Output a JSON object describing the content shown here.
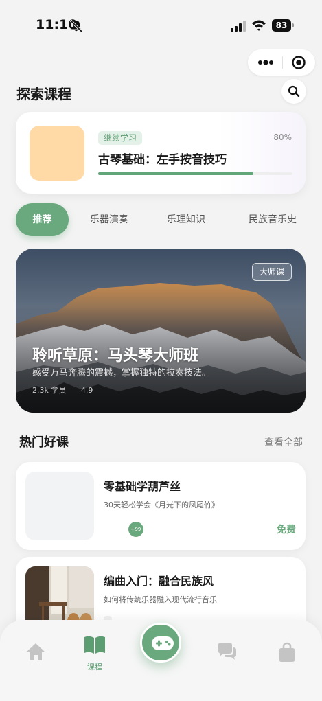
{
  "status_bar": {
    "time": "11:10",
    "battery": "83"
  },
  "header": {
    "title": "探索课程"
  },
  "continue_learning": {
    "badge": "继续学习",
    "percent_label": "80%",
    "progress": 0.8,
    "title": "古琴基础：左手按音技巧",
    "thumb_color": "#ffd9a6"
  },
  "category_tabs": [
    {
      "label": "推荐",
      "active": true
    },
    {
      "label": "乐器演奏",
      "active": false
    },
    {
      "label": "乐理知识",
      "active": false
    },
    {
      "label": "民族音乐史",
      "active": false
    }
  ],
  "featured": {
    "badge": "大师课",
    "title": "聆听草原：马头琴大师班",
    "subtitle": "感受万马奔腾的震撼，掌握独特的拉奏技法。",
    "students": "2.3k 学员",
    "rating": "4.9"
  },
  "popular": {
    "title": "热门好课",
    "see_all": "查看全部",
    "courses": [
      {
        "title": "零基础学葫芦丝",
        "desc": "30天轻松学会《月光下的凤尾竹》",
        "avatar_count": "+99",
        "price": "免费"
      },
      {
        "title": "编曲入门：融合民族风",
        "desc": "如何将传统乐器融入现代流行音乐"
      }
    ]
  },
  "bottom_nav": {
    "items": [
      {
        "icon": "home-icon",
        "label": ""
      },
      {
        "icon": "book-icon",
        "label": "课程",
        "active": true
      },
      {
        "icon": "gamepad-icon",
        "label": ""
      },
      {
        "icon": "chat-icon",
        "label": ""
      },
      {
        "icon": "bag-icon",
        "label": ""
      }
    ]
  },
  "colors": {
    "accent": "#6aa97e",
    "background": "#f3f3f3",
    "badge_bg": "#e4f1e8"
  }
}
